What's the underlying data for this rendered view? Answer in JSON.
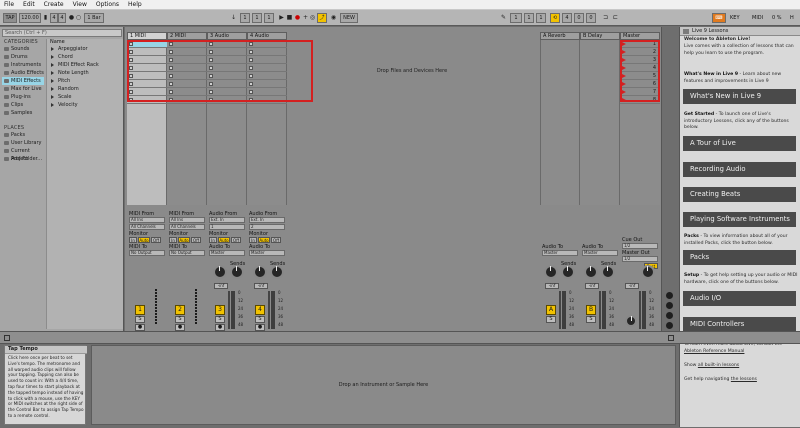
{
  "menu": [
    "File",
    "Edit",
    "Create",
    "View",
    "Options",
    "Help"
  ],
  "control_bar": {
    "tap": "TAP",
    "tempo": "120.00",
    "signature_num": "4",
    "signature_den": "4",
    "quantize": "1 Bar",
    "position_bar": "1",
    "position_beat": "1",
    "position_sixteenth": "1",
    "loop_start": "1",
    "loop_length": "4",
    "loop_sub": "0",
    "new": "NEW",
    "key": "KEY",
    "midi": "MIDI",
    "cpu": "0 %",
    "h_label": "H",
    "accent_yellow": "#f2c200",
    "accent_orange": "#e07a1f"
  },
  "browser": {
    "search_placeholder": "Search (Ctrl + F)",
    "categories_title": "CATEGORIES",
    "categories": [
      {
        "label": "Sounds",
        "icon": "speaker-icon"
      },
      {
        "label": "Drums",
        "icon": "drum-icon"
      },
      {
        "label": "Instruments",
        "icon": "keyboard-icon"
      },
      {
        "label": "Audio Effects",
        "icon": "waveform-icon"
      },
      {
        "label": "MIDI Effects",
        "icon": "midi-icon",
        "selected": true
      },
      {
        "label": "Max for Live",
        "icon": "max-icon"
      },
      {
        "label": "Plug-ins",
        "icon": "plug-icon"
      },
      {
        "label": "Clips",
        "icon": "clip-icon"
      },
      {
        "label": "Samples",
        "icon": "sample-icon"
      }
    ],
    "places_title": "PLACES",
    "places": [
      {
        "label": "Packs",
        "icon": "package-icon"
      },
      {
        "label": "User Library",
        "icon": "folder-icon"
      },
      {
        "label": "Current Project",
        "icon": "folder-icon"
      },
      {
        "label": "Add Folder...",
        "icon": "plus-icon"
      }
    ],
    "list_header": "Name",
    "list_items": [
      "Arpeggiator",
      "Chord",
      "MIDI Effect Rack",
      "Note Length",
      "Pitch",
      "Random",
      "Scale",
      "Velocity"
    ]
  },
  "tracks": [
    {
      "name": "1 MIDI",
      "type": "midi",
      "number": "1"
    },
    {
      "name": "2 MIDI",
      "type": "midi",
      "number": "2"
    },
    {
      "name": "3 Audio",
      "type": "audio",
      "number": "3"
    },
    {
      "name": "4 Audio",
      "type": "audio",
      "number": "4"
    }
  ],
  "returns": [
    {
      "name": "A Reverb",
      "letter": "A"
    },
    {
      "name": "B Delay",
      "letter": "B"
    }
  ],
  "master": {
    "name": "Master",
    "scenes": [
      "1",
      "2",
      "3",
      "4",
      "5",
      "6",
      "7",
      "8"
    ]
  },
  "drop_files": "Drop Files and Devices Here",
  "drop_instrument": "Drop an Instrument or Sample Here",
  "mixer": {
    "midi_from": "MIDI From",
    "all_ins": "All Ins",
    "all_channels": "All Channels",
    "audio_from": "Audio From",
    "ext_in": "Ext. In",
    "ch1": "1",
    "ch2": "2",
    "monitor": "Monitor",
    "in": "In",
    "auto": "Auto",
    "off": "Off",
    "midi_to": "MIDI To",
    "no_output": "No Output",
    "audio_to": "Audio To",
    "master_out": "Master",
    "sends": "Sends",
    "cue_out": "Cue Out",
    "cue_val": "1/2",
    "master_out_label": "Master Out",
    "post": "Post",
    "vol_inf": "-inf",
    "scale_0": "0",
    "scale_12": "12",
    "scale_24": "24",
    "scale_36": "36",
    "scale_48": "48",
    "scale_60": "60",
    "s_label": "S"
  },
  "help": {
    "title": "Live 9 Lessons",
    "welcome": "Welcome to Ableton Live!",
    "intro": "Live comes with a collection of lessons that can help you learn to use the program.",
    "whats_new_head": "What's New in Live 9",
    "whats_new_text": "- Learn about new features and improvements in Live 9",
    "btn_whats_new": "What's New in Live 9",
    "get_started_head": "Get Started",
    "get_started_text": "- To launch one of Live's introductory Lessons, click any of the buttons below.",
    "btn_tour": "A Tour of Live",
    "btn_recording": "Recording Audio",
    "btn_beats": "Creating Beats",
    "btn_software": "Playing Software Instruments",
    "packs_head": "Packs",
    "packs_text": "- To view information about all of your installed Packs, click the button below.",
    "btn_packs": "Packs",
    "setup_head": "Setup",
    "setup_text": "- To get help setting up your audio or MIDI hardware, click one of the buttons below.",
    "btn_audio_io": "Audio I/O",
    "btn_midi_ctrl": "MIDI Controllers",
    "more_text": "To learn even more about Live, consult the",
    "manual_link": "Ableton Reference Manual",
    "show_all_prefix": "Show",
    "show_all_link": "all built-in lessons",
    "nav_prefix": "Get help navigating",
    "nav_link": "the lessons"
  },
  "info": {
    "title": "Tap Tempo",
    "body": "Click here once per beat to set Live's tempo. The metronome and all warped audio clips will follow your tapping. Tapping can also be used to count in: With a 4/4 time, tap four times to start playback at the tapped tempo instead of having to click with a mouse, use the KEY or MIDI switches at the right side of the Control Bar to assign Tap Tempo to a remote control."
  }
}
